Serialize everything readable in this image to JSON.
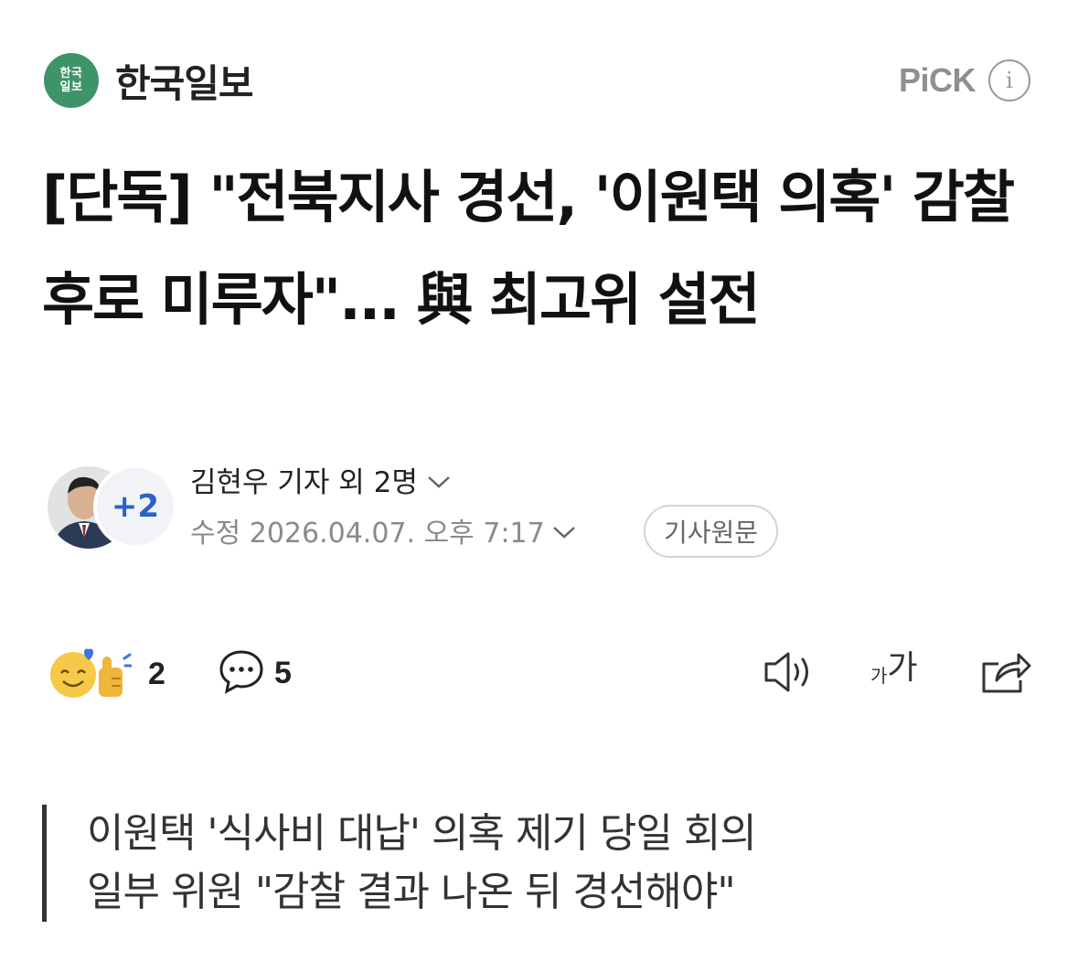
{
  "press": {
    "logo_line1": "한국",
    "logo_line2": "일보",
    "name": "한국일보",
    "pick_label": "PiCK",
    "info_icon": "info-icon",
    "brand_color": "#3f9369"
  },
  "article": {
    "headline": "[단독] \"전북지사 경선, '이원택 의혹' 감찰 후로 미루자\"... 與 최고위 설전"
  },
  "byline": {
    "extra_reporters": "+2",
    "reporter": "김현우 기자 외 2명",
    "date": "수정 2026.04.07. 오후 7:17",
    "origin_label": "기사원문",
    "accent_color": "#2a62c9"
  },
  "actions": {
    "reaction_count": "2",
    "comment_count": "5",
    "font_small": "가",
    "font_big": "가",
    "icons": [
      "reaction-emoji-icon",
      "comment-icon",
      "speaker-icon",
      "font-size-icon",
      "share-icon"
    ]
  },
  "summary": {
    "lines": [
      "이원택 '식사비 대납' 의혹 제기 당일 회의",
      "일부 위원 \"감찰 결과 나온 뒤 경선해야\""
    ]
  }
}
